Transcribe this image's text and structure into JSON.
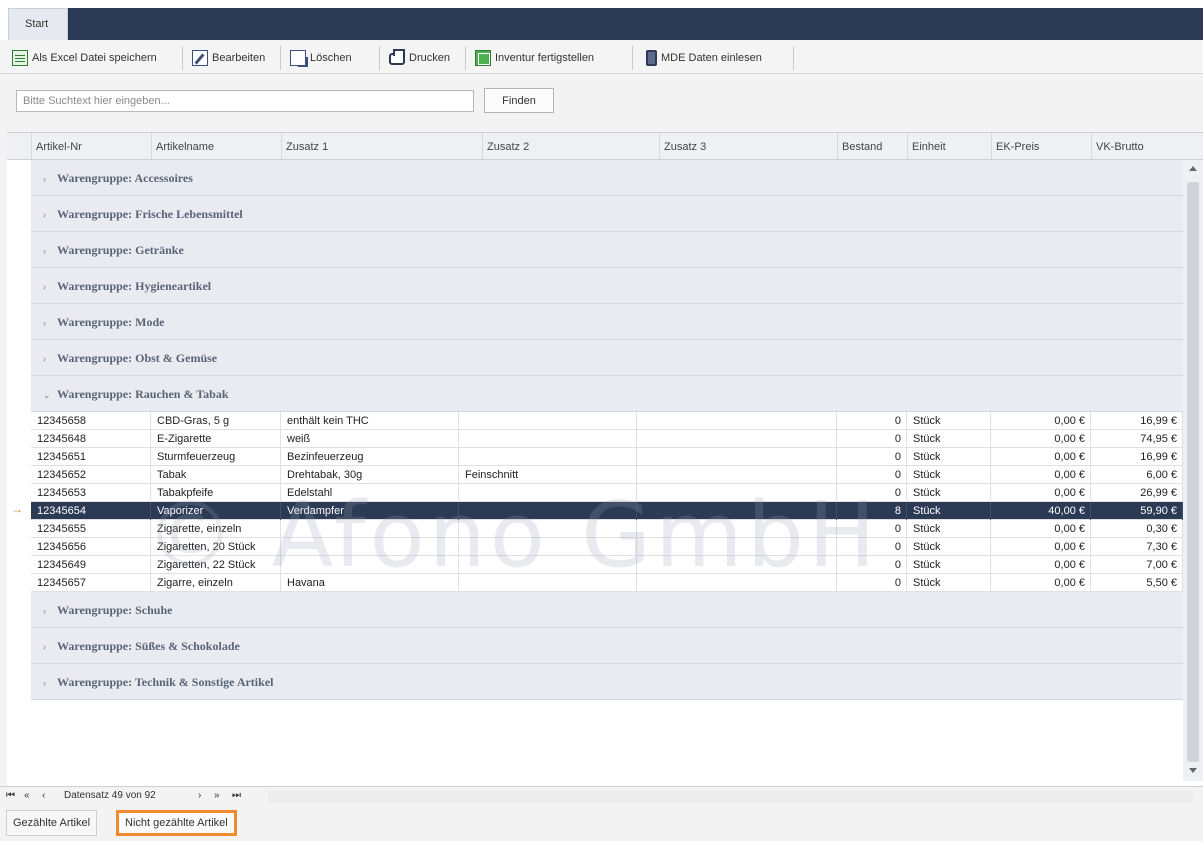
{
  "ribbon": {
    "tab_start": "Start"
  },
  "toolbar": {
    "excel": "Als Excel Datei speichern",
    "edit": "Bearbeiten",
    "delete": "Löschen",
    "print": "Drucken",
    "inventory": "Inventur fertigstellen",
    "mde": "MDE Daten einlesen"
  },
  "search": {
    "placeholder": "Bitte Suchtext hier eingeben...",
    "button": "Finden"
  },
  "columns": [
    "Artikel-Nr",
    "Artikelname",
    "Zusatz 1",
    "Zusatz 2",
    "Zusatz 3",
    "Bestand",
    "Einheit",
    "EK-Preis",
    "VK-Brutto"
  ],
  "groups_before": [
    "Warengruppe: Accessoires",
    "Warengruppe: Frische Lebensmittel",
    "Warengruppe: Getränke",
    "Warengruppe: Hygieneartikel",
    "Warengruppe: Mode",
    "Warengruppe: Obst & Gemüse"
  ],
  "expanded_group": "Warengruppe: Rauchen & Tabak",
  "rows": [
    [
      "12345658",
      "CBD-Gras, 5 g",
      "enthält kein THC",
      "",
      "",
      "0",
      "Stück",
      "0,00 €",
      "16,99 €"
    ],
    [
      "12345648",
      "E-Zigarette",
      "weiß",
      "",
      "",
      "0",
      "Stück",
      "0,00 €",
      "74,95 €"
    ],
    [
      "12345651",
      "Sturmfeuerzeug",
      "Bezinfeuerzeug",
      "",
      "",
      "0",
      "Stück",
      "0,00 €",
      "16,99 €"
    ],
    [
      "12345652",
      "Tabak",
      "Drehtabak, 30g",
      "Feinschnitt",
      "",
      "0",
      "Stück",
      "0,00 €",
      "6,00 €"
    ],
    [
      "12345653",
      "Tabakpfeife",
      "Edelstahl",
      "",
      "",
      "0",
      "Stück",
      "0,00 €",
      "26,99 €"
    ],
    [
      "12345654",
      "Vaporizer",
      "Verdampfer",
      "",
      "",
      "8",
      "Stück",
      "40,00 €",
      "59,90 €"
    ],
    [
      "12345655",
      "Zigarette, einzeln",
      "",
      "",
      "",
      "0",
      "Stück",
      "0,00 €",
      "0,30 €"
    ],
    [
      "12345656",
      "Zigaretten, 20 Stück",
      "",
      "",
      "",
      "0",
      "Stück",
      "0,00 €",
      "7,30 €"
    ],
    [
      "12345649",
      "Zigaretten, 22 Stück",
      "",
      "",
      "",
      "0",
      "Stück",
      "0,00 €",
      "7,00 €"
    ],
    [
      "12345657",
      "Zigarre, einzeln",
      "Havana",
      "",
      "",
      "0",
      "Stück",
      "0,00 €",
      "5,50 €"
    ]
  ],
  "selected_row_index": 5,
  "groups_after": [
    "Warengruppe: Schuhe",
    "Warengruppe: Süßes & Schokolade",
    "Warengruppe: Technik & Sonstige Artikel"
  ],
  "navigator": {
    "record_text": "Datensatz 49 von 92"
  },
  "bottom_tabs": {
    "counted": "Gezählte Artikel",
    "not_counted": "Nicht gezählte Artikel"
  },
  "watermark": "© Afono GmbH",
  "colors": {
    "header_dark": "#2c3a55",
    "selection": "#2c3a55",
    "highlight_border": "#f08a2c"
  },
  "icons": {
    "excel": "excel-icon",
    "edit": "edit-icon",
    "delete": "delete-icon",
    "print": "printer-icon",
    "inventory": "inventory-icon",
    "mde": "mobile-device-icon"
  }
}
